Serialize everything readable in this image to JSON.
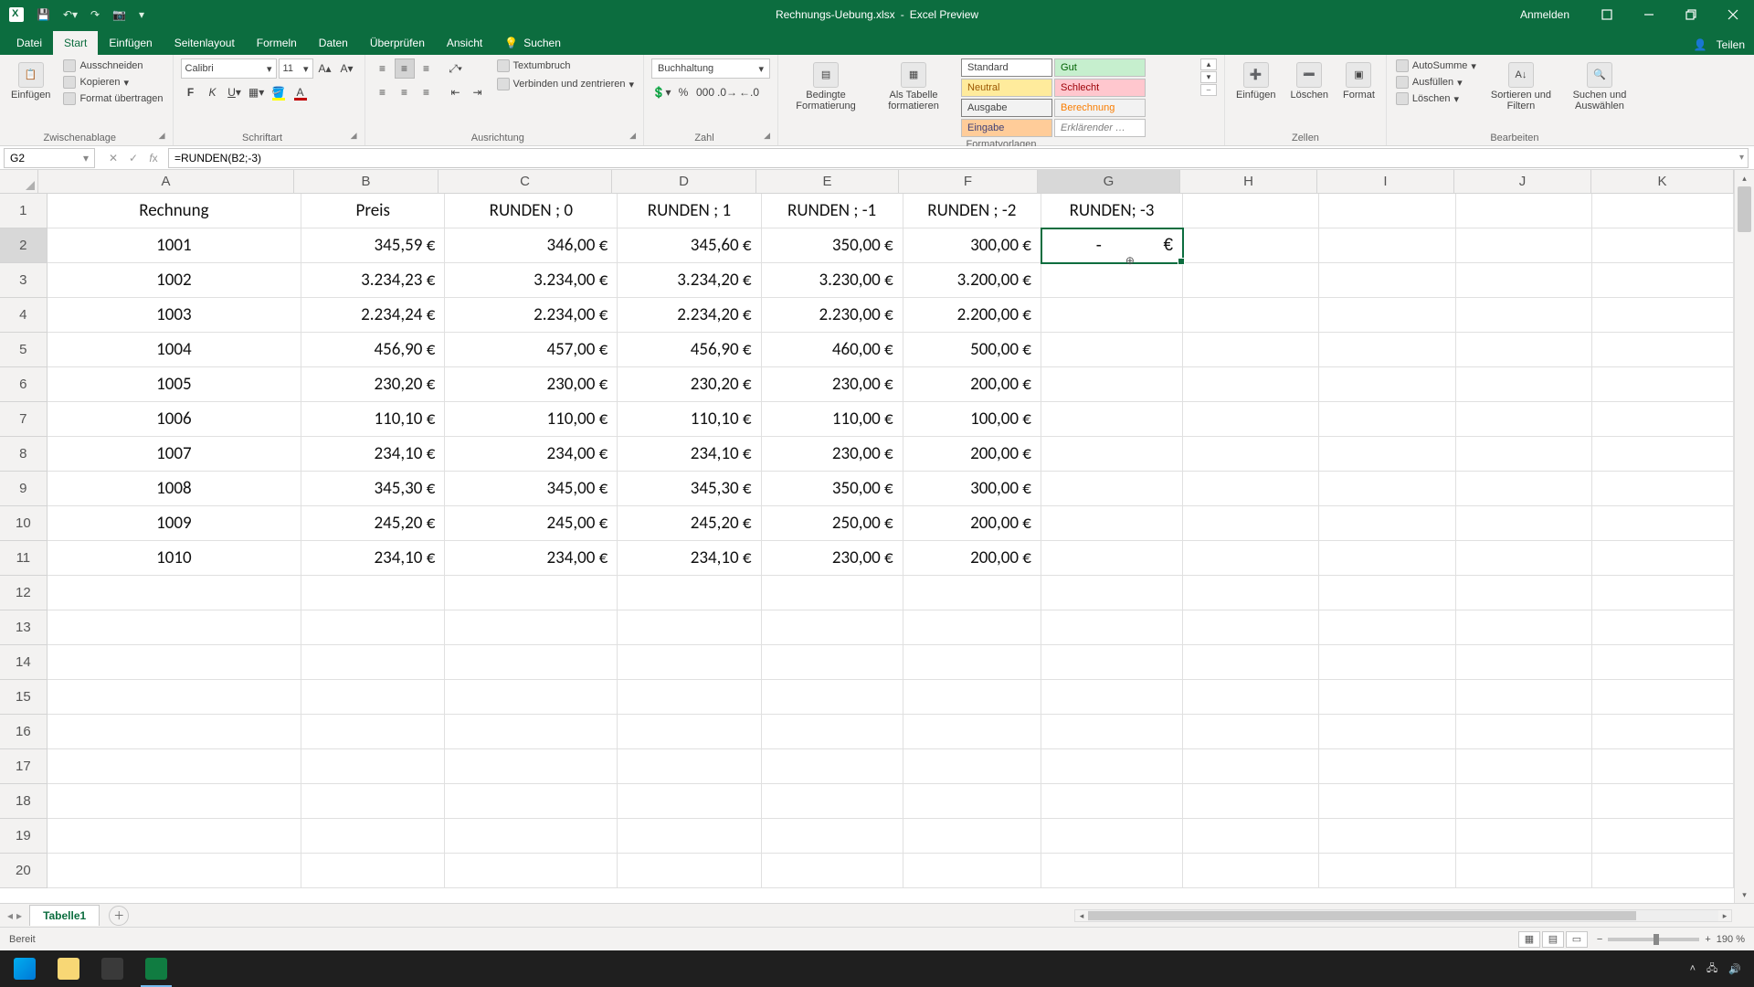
{
  "title": {
    "filename": "Rechnungs-Uebung.xlsx",
    "app": "Excel Preview"
  },
  "account": {
    "signin": "Anmelden"
  },
  "tabs": {
    "file": "Datei",
    "home": "Start",
    "insert": "Einfügen",
    "layout": "Seitenlayout",
    "formulas": "Formeln",
    "data": "Daten",
    "review": "Überprüfen",
    "view": "Ansicht",
    "search": "Suchen",
    "share": "Teilen"
  },
  "ribbon": {
    "clipboard": {
      "paste": "Einfügen",
      "cut": "Ausschneiden",
      "copy": "Kopieren",
      "format_painter": "Format übertragen",
      "label": "Zwischenablage"
    },
    "font": {
      "name": "Calibri",
      "size": "11",
      "label": "Schriftart"
    },
    "alignment": {
      "wrap": "Textumbruch",
      "merge": "Verbinden und zentrieren",
      "label": "Ausrichtung"
    },
    "number": {
      "format": "Buchhaltung",
      "label": "Zahl"
    },
    "styles": {
      "conditional": "Bedingte Formatierung",
      "as_table": "Als Tabelle formatieren",
      "standard": "Standard",
      "gut": "Gut",
      "neutral": "Neutral",
      "schlecht": "Schlecht",
      "ausgabe": "Ausgabe",
      "berechnung": "Berechnung",
      "eingabe": "Eingabe",
      "erklarender": "Erklärender …",
      "label": "Formatvorlagen"
    },
    "cells": {
      "insert": "Einfügen",
      "delete": "Löschen",
      "format": "Format",
      "label": "Zellen"
    },
    "editing": {
      "autosum": "AutoSumme",
      "fill": "Ausfüllen",
      "clear": "Löschen",
      "sort": "Sortieren und Filtern",
      "find": "Suchen und Auswählen",
      "label": "Bearbeiten"
    }
  },
  "namebox": "G2",
  "formula": "=RUNDEN(B2;-3)",
  "columns": [
    "A",
    "B",
    "C",
    "D",
    "E",
    "F",
    "G",
    "H",
    "I",
    "J",
    "K"
  ],
  "active": {
    "col": "G",
    "row": 2
  },
  "headers": {
    "A": "Rechnung",
    "B": "Preis",
    "C": "RUNDEN ; 0",
    "D": "RUNDEN ; 1",
    "E": "RUNDEN ; -1",
    "F": "RUNDEN ; -2",
    "G": "RUNDEN; -3"
  },
  "rows": [
    {
      "A": "1001",
      "B": "345,59 €",
      "C": "346,00 €",
      "D": "345,60 €",
      "E": "350,00 €",
      "F": "300,00 €",
      "G": "-   €"
    },
    {
      "A": "1002",
      "B": "3.234,23 €",
      "C": "3.234,00 €",
      "D": "3.234,20 €",
      "E": "3.230,00 €",
      "F": "3.200,00 €",
      "G": ""
    },
    {
      "A": "1003",
      "B": "2.234,24 €",
      "C": "2.234,00 €",
      "D": "2.234,20 €",
      "E": "2.230,00 €",
      "F": "2.200,00 €",
      "G": ""
    },
    {
      "A": "1004",
      "B": "456,90 €",
      "C": "457,00 €",
      "D": "456,90 €",
      "E": "460,00 €",
      "F": "500,00 €",
      "G": ""
    },
    {
      "A": "1005",
      "B": "230,20 €",
      "C": "230,00 €",
      "D": "230,20 €",
      "E": "230,00 €",
      "F": "200,00 €",
      "G": ""
    },
    {
      "A": "1006",
      "B": "110,10 €",
      "C": "110,00 €",
      "D": "110,10 €",
      "E": "110,00 €",
      "F": "100,00 €",
      "G": ""
    },
    {
      "A": "1007",
      "B": "234,10 €",
      "C": "234,00 €",
      "D": "234,10 €",
      "E": "230,00 €",
      "F": "200,00 €",
      "G": ""
    },
    {
      "A": "1008",
      "B": "345,30 €",
      "C": "345,00 €",
      "D": "345,30 €",
      "E": "350,00 €",
      "F": "300,00 €",
      "G": ""
    },
    {
      "A": "1009",
      "B": "245,20 €",
      "C": "245,00 €",
      "D": "245,20 €",
      "E": "250,00 €",
      "F": "200,00 €",
      "G": ""
    },
    {
      "A": "1010",
      "B": "234,10 €",
      "C": "234,00 €",
      "D": "234,10 €",
      "E": "230,00 €",
      "F": "200,00 €",
      "G": ""
    }
  ],
  "sheet": {
    "name": "Tabelle1"
  },
  "status": {
    "ready": "Bereit",
    "zoom": "190 %"
  }
}
